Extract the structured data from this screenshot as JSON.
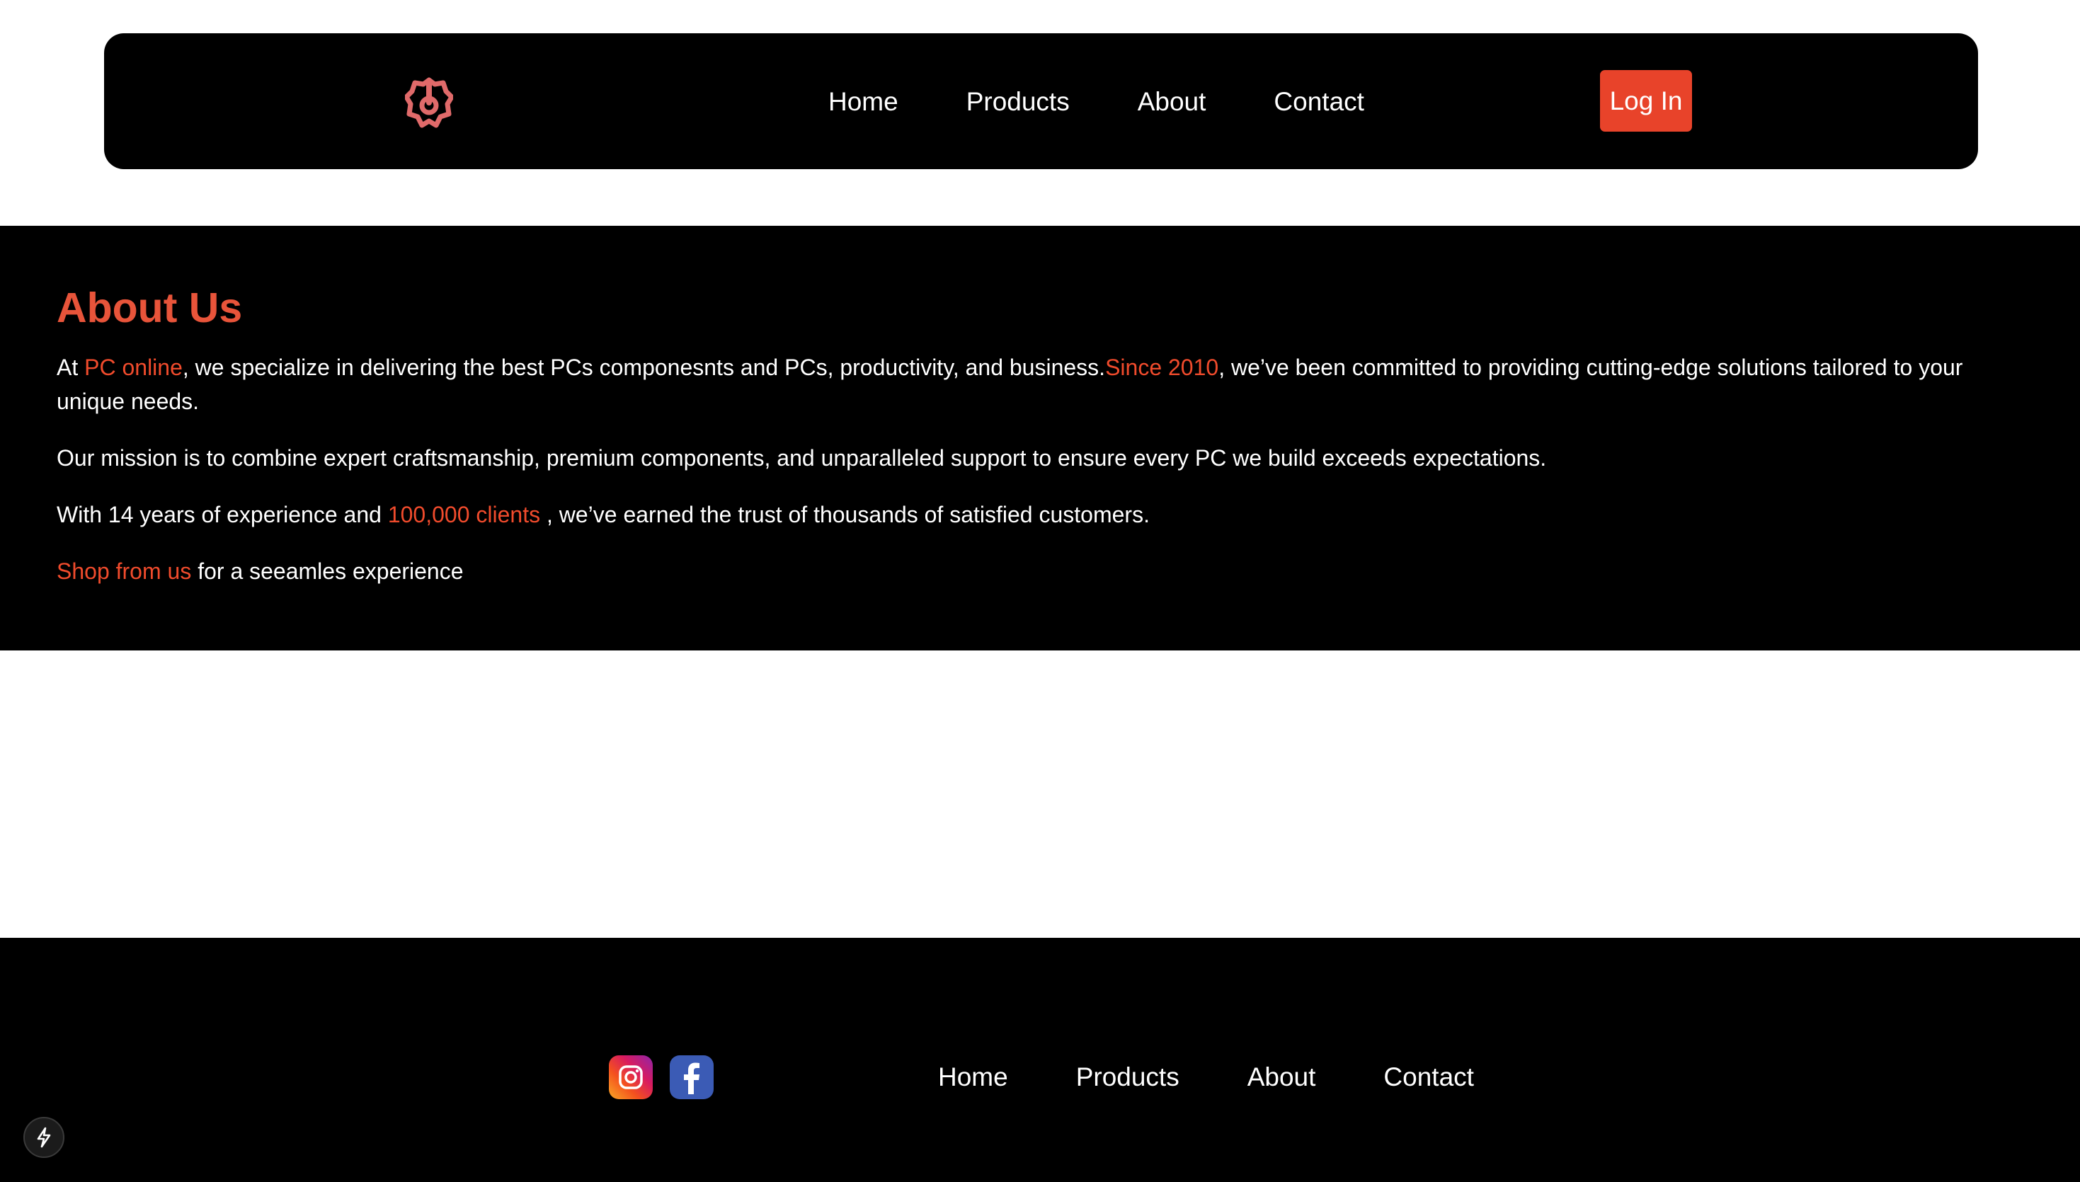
{
  "header": {
    "logo_icon": "brand-logo-icon",
    "nav": [
      {
        "label": "Home"
      },
      {
        "label": "Products"
      },
      {
        "label": "About"
      },
      {
        "label": "Contact"
      }
    ],
    "login_label": "Log In"
  },
  "about": {
    "title": "About Us",
    "p1": {
      "t1": "At ",
      "brand": "PC online",
      "t2": ", we specialize in delivering the best PCs componesnts and PCs, productivity, and business.",
      "since": "Since 2010",
      "t3": ", we’ve been committed to providing cutting-edge solutions tailored to your unique needs."
    },
    "p2": "Our mission is to combine expert craftsmanship, premium components, and unparalleled support to ensure every PC we build exceeds expectations.",
    "p3": {
      "t1": "With 14 years of experience and ",
      "clients": "100,000 clients",
      "t2": " , we’ve earned the trust of thousands of satisfied customers."
    },
    "p4": {
      "shop": "Shop from us",
      "t1": " for a seeamles experience"
    }
  },
  "footer": {
    "social": [
      {
        "icon": "instagram-icon"
      },
      {
        "icon": "facebook-icon"
      }
    ],
    "nav": [
      {
        "label": "Home"
      },
      {
        "label": "Products"
      },
      {
        "label": "About"
      },
      {
        "label": "Contact"
      }
    ]
  },
  "colors": {
    "accent": "#e8432a",
    "background_dark": "#000000",
    "background_light": "#ffffff"
  }
}
